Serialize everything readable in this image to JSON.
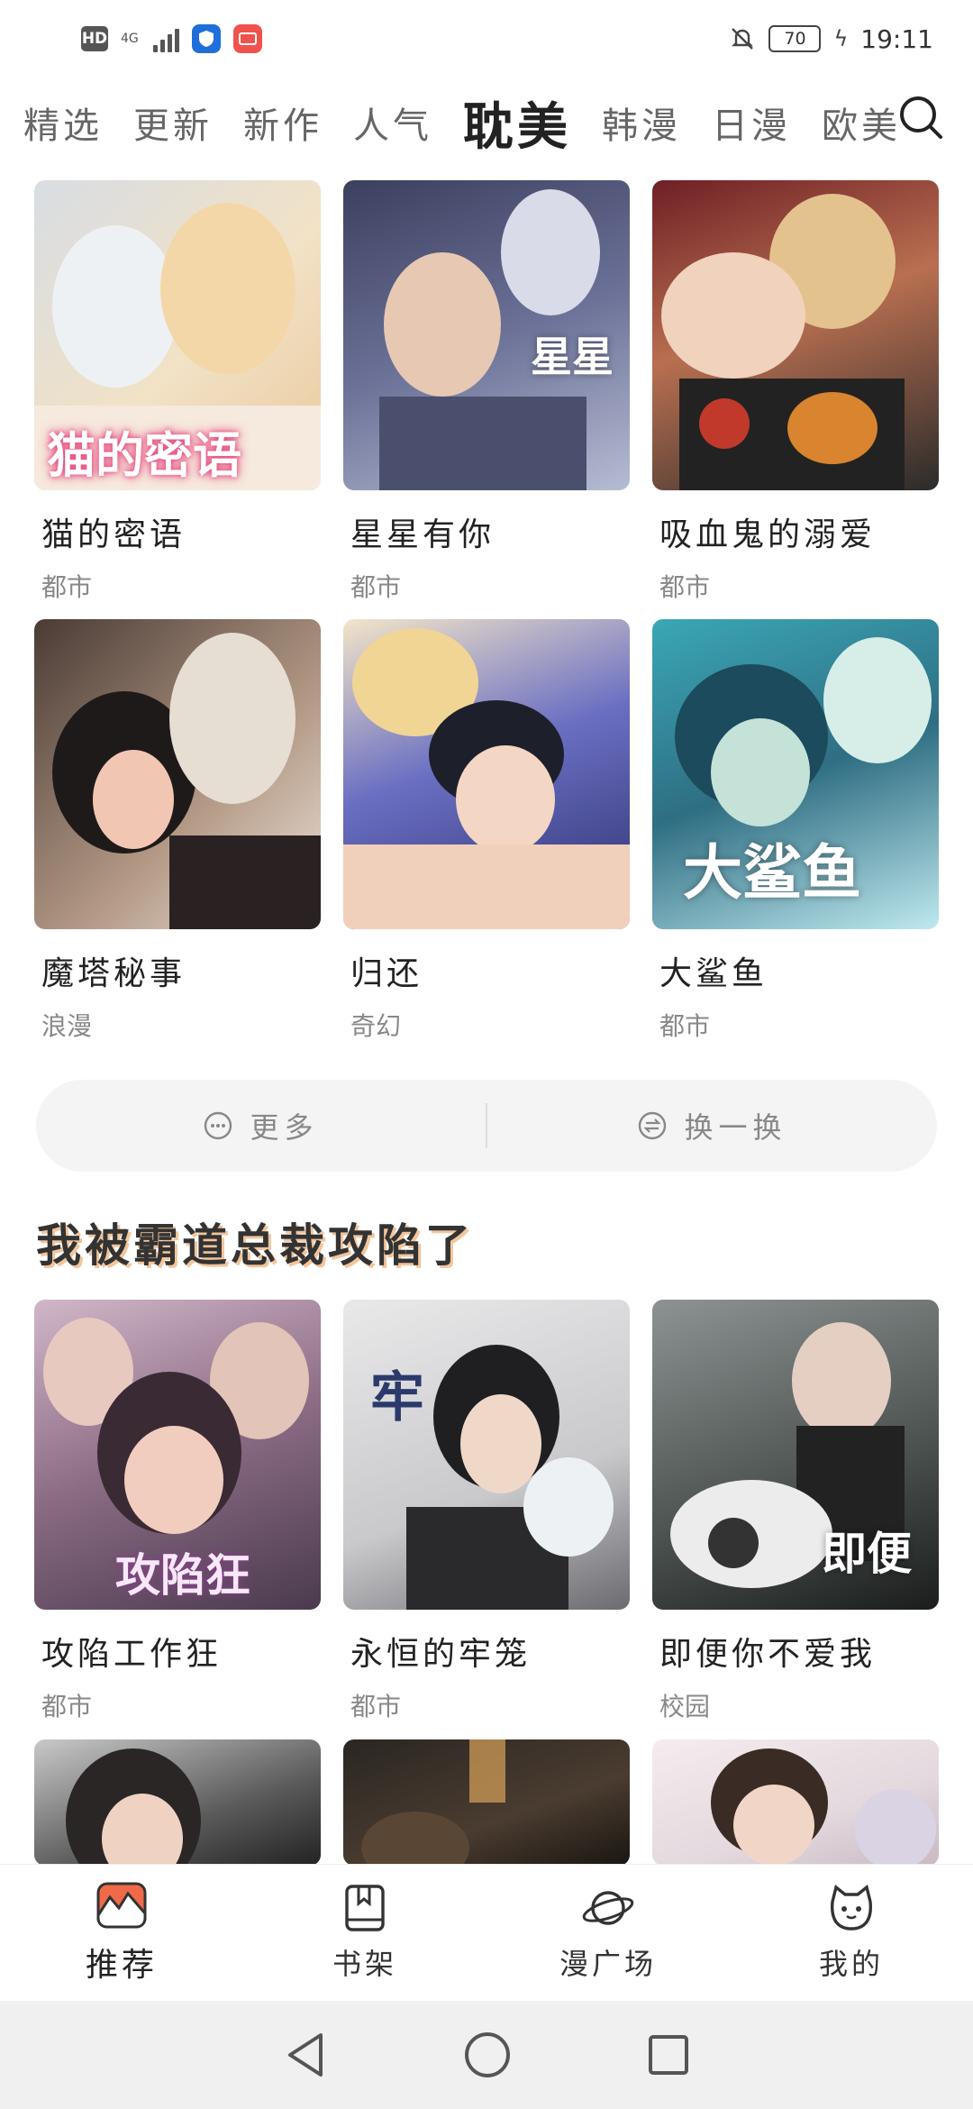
{
  "status_bar": {
    "network_badge": "HD",
    "network_type": "4G",
    "battery_level": "70",
    "time": "19:11"
  },
  "tabs": [
    {
      "label": "精选"
    },
    {
      "label": "更新"
    },
    {
      "label": "新作"
    },
    {
      "label": "人气"
    },
    {
      "label": "耽美"
    },
    {
      "label": "韩漫"
    },
    {
      "label": "日漫"
    },
    {
      "label": "欧美"
    }
  ],
  "top_grid": [
    {
      "title": "猫的密语",
      "genre": "都市",
      "cover_text": "猫的密语"
    },
    {
      "title": "星星有你",
      "genre": "都市",
      "cover_text": "星星"
    },
    {
      "title": "吸血鬼的溺爱",
      "genre": "都市"
    },
    {
      "title": "魔塔秘事",
      "genre": "浪漫"
    },
    {
      "title": "归还",
      "genre": "奇幻"
    },
    {
      "title": "大鲨鱼",
      "genre": "都市",
      "cover_text": "大鲨鱼"
    }
  ],
  "actions": {
    "more_label": "更多",
    "refresh_label": "换一换"
  },
  "section": {
    "title": "我被霸道总裁攻陷了"
  },
  "bottom_grid": [
    {
      "title": "攻陷工作狂",
      "genre": "都市",
      "cover_text": "攻陷狂"
    },
    {
      "title": "永恒的牢笼",
      "genre": "都市",
      "cover_text": "牢"
    },
    {
      "title": "即便你不爱我",
      "genre": "校园",
      "cover_text": "即便"
    }
  ],
  "bottom_nav": [
    {
      "label": "推荐"
    },
    {
      "label": "书架"
    },
    {
      "label": "漫广场"
    },
    {
      "label": "我的"
    }
  ],
  "colors": {
    "accent": "#f06a4a",
    "section_shadow": "#f3c59b"
  }
}
